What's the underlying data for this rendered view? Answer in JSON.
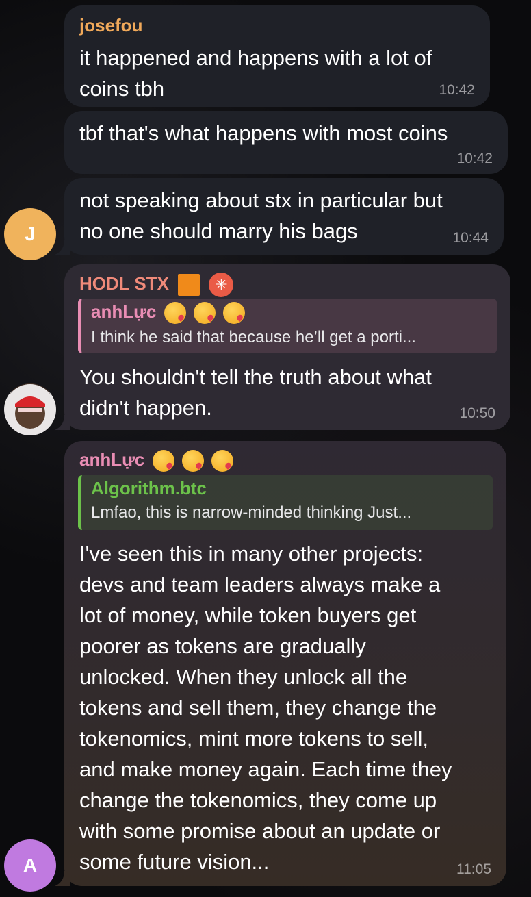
{
  "messages": [
    {
      "sender": "josefou",
      "text": "it happened and happens with a lot of\ncoins tbh",
      "time": "10:42"
    },
    {
      "text": "tbf that's what happens with most coins",
      "time": "10:42"
    },
    {
      "text": "not speaking about stx in particular but\nno one should marry his bags",
      "time": "10:44",
      "avatar_initial": "J"
    },
    {
      "sender": "HODL STX",
      "sender_badges": [
        "orange-square-icon",
        "stacks-logo-icon"
      ],
      "reply": {
        "name": "anhLực",
        "text": "I think he said that because he’ll get a porti..."
      },
      "text": "You shouldn't tell the truth about what\ndidn't happen.",
      "time": "10:50"
    },
    {
      "sender": "anhLực",
      "sender_emoji": [
        "kissing-face-icon",
        "kissing-face-icon",
        "kissing-face-icon"
      ],
      "reply": {
        "name": "Algorithm.btc",
        "text": "Lmfao, this is narrow-minded thinking Just..."
      },
      "text": "I've seen this in many other projects:\ndevs and team leaders always make a\nlot of money, while token buyers get\npoorer as tokens are gradually\nunlocked. When they unlock all the\ntokens and sell them, they change the\ntokenomics, mint more tokens to sell,\nand make money again. Each time they\nchange the tokenomics, they come up\nwith some promise about an update or\nsome future vision...",
      "time": "11:05",
      "avatar_initial": "A"
    }
  ],
  "colors": {
    "josefou": "#f0a95a",
    "hodl": "#f08a7a",
    "anh": "#e98db4",
    "algorithm": "#6cc24a",
    "avatar_j": "#f0b35c",
    "avatar_a": "#c07ae0"
  }
}
